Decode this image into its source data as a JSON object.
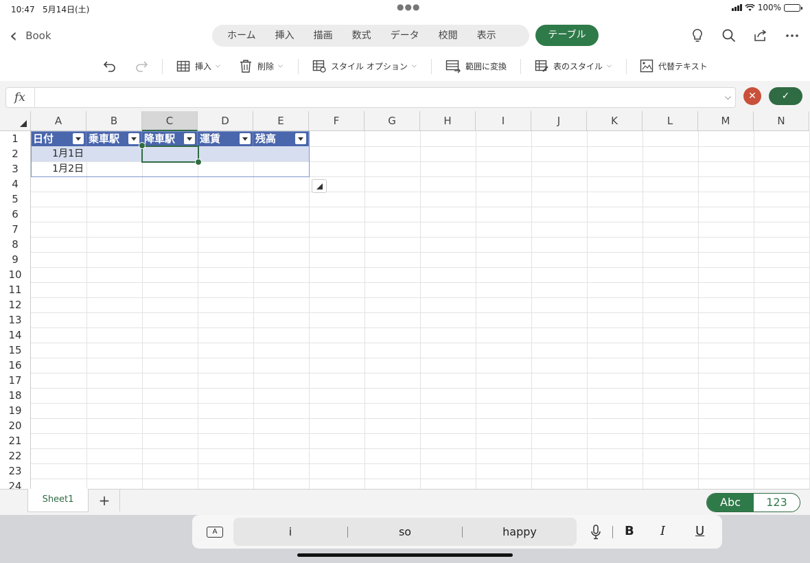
{
  "status": {
    "time": "10:47",
    "date": "5月14日(土)",
    "battery": "100%"
  },
  "nav": {
    "back_label": "Book",
    "tabs": [
      "ホーム",
      "挿入",
      "描画",
      "数式",
      "データ",
      "校閲",
      "表示"
    ],
    "active_tab": "テーブル"
  },
  "ribbon": {
    "insert": "挿入",
    "delete": "削除",
    "style_options": "スタイル オプション",
    "convert_range": "範囲に変換",
    "table_styles": "表のスタイル",
    "alt_text": "代替テキスト"
  },
  "formula": {
    "label": "fx",
    "value": ""
  },
  "columns": [
    "A",
    "B",
    "C",
    "D",
    "E",
    "F",
    "G",
    "H",
    "I",
    "J",
    "K",
    "L",
    "M",
    "N"
  ],
  "rows": [
    "1",
    "2",
    "3",
    "4",
    "5",
    "6",
    "7",
    "8",
    "9",
    "10",
    "11",
    "12",
    "13",
    "14",
    "15",
    "16",
    "17",
    "18",
    "19",
    "20",
    "21",
    "22",
    "23",
    "24"
  ],
  "table": {
    "headers": [
      "日付",
      "乗車駅",
      "降車駅",
      "運賃",
      "残高"
    ],
    "rows": [
      [
        "1月1日",
        "",
        "",
        "",
        ""
      ],
      [
        "1月2日",
        "",
        "",
        "",
        ""
      ]
    ]
  },
  "sheet": {
    "tab": "Sheet1",
    "add": "+"
  },
  "input_mode": {
    "abc": "Abc",
    "num": "123"
  },
  "keyboard": {
    "suggestions": [
      "i",
      "so",
      "happy"
    ],
    "bold": "B",
    "italic": "I",
    "underline": "U"
  },
  "colors": {
    "accent": "#2f7a49",
    "table_header": "#4a66ac",
    "band": "#d6deef",
    "cancel": "#c9503a"
  }
}
